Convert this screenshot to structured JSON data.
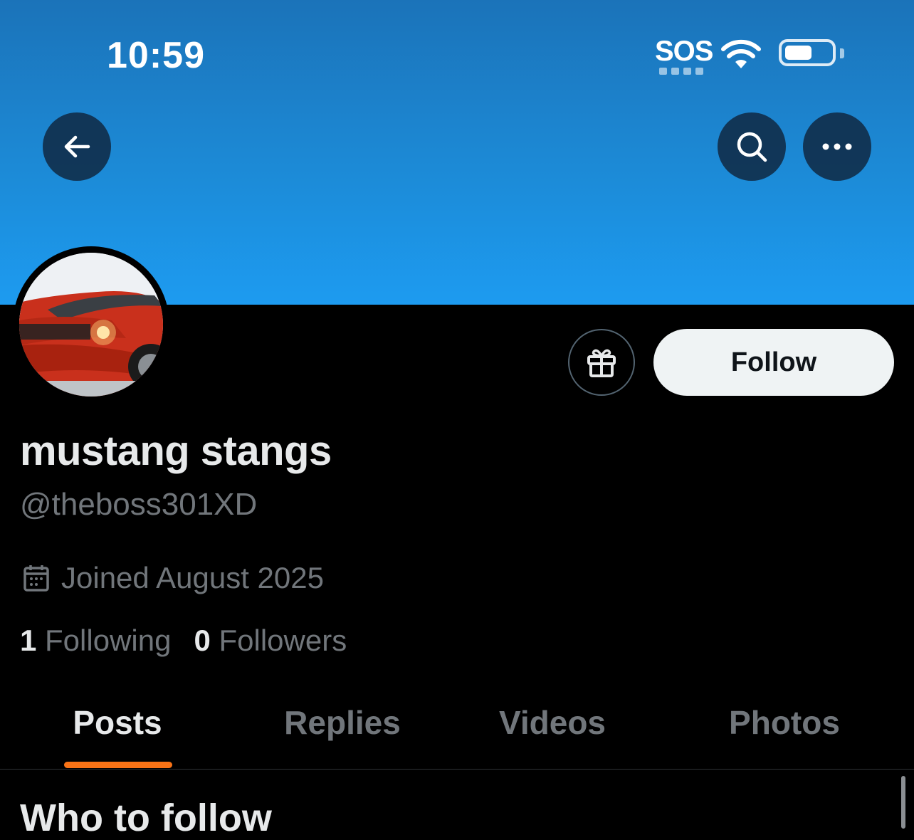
{
  "status_bar": {
    "time": "10:59",
    "carrier": "SOS",
    "wifi_icon": "wifi-icon",
    "battery_icon": "battery-icon",
    "battery_level": 0.6
  },
  "nav": {
    "back_icon": "arrow-left-icon",
    "search_icon": "search-icon",
    "more_icon": "more-horizontal-icon"
  },
  "colors": {
    "banner": "#1d9bf0",
    "accent_tab": "#f97316",
    "follow_bg": "#eff3f4"
  },
  "profile": {
    "display_name": "mustang stangs",
    "handle": "@theboss301XD",
    "joined": "Joined August 2025",
    "following_count": "1",
    "following_label": "Following",
    "followers_count": "0",
    "followers_label": "Followers"
  },
  "actions": {
    "gift_icon": "gift-icon",
    "follow_label": "Follow"
  },
  "tabs": [
    {
      "label": "Posts",
      "active": true
    },
    {
      "label": "Replies",
      "active": false
    },
    {
      "label": "Videos",
      "active": false
    },
    {
      "label": "Photos",
      "active": false
    }
  ],
  "who_to_follow": {
    "title": "Who to follow"
  }
}
